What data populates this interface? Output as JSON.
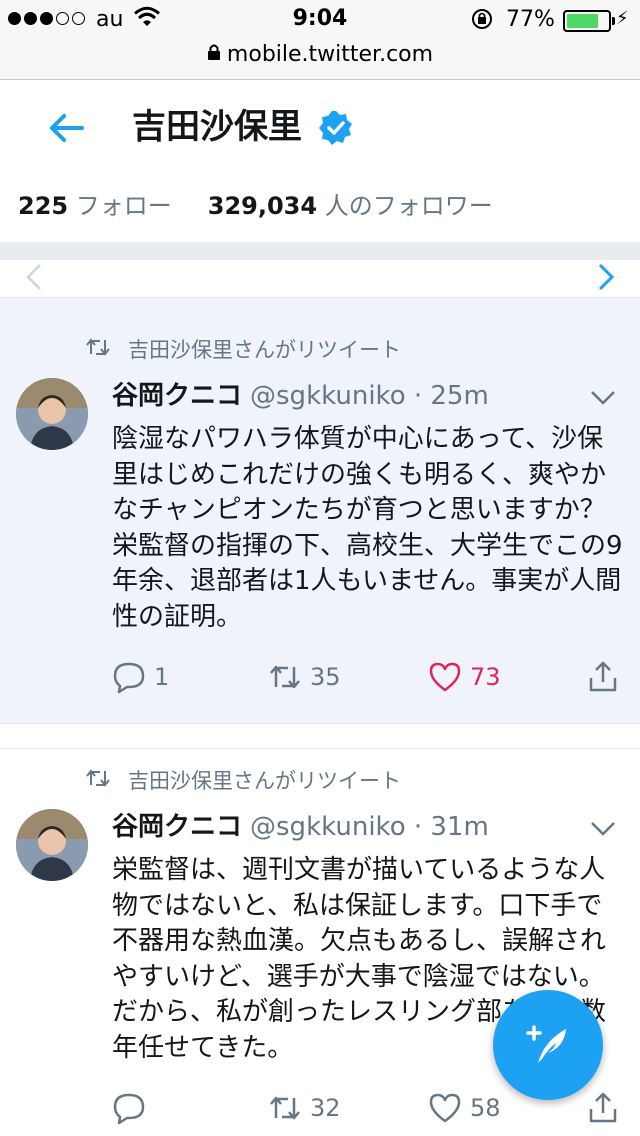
{
  "status_bar": {
    "carrier": "au",
    "time": "9:04",
    "battery_pct": "77%",
    "battery_level": 0.77
  },
  "url_bar": {
    "host": "mobile.twitter.com"
  },
  "profile": {
    "name": "吉田沙保里",
    "following_count": "225",
    "following_label": "フォロー",
    "followers_count": "329,034",
    "followers_label": "人のフォロワー"
  },
  "colors": {
    "accent": "#1da1f2",
    "like": "#e0245e",
    "muted": "#657786"
  },
  "tweets": [
    {
      "retweet_context": "吉田沙保里さんがリツイート",
      "author": "谷岡クニコ",
      "handle_time": "@sgkkuniko · 25m",
      "text": "陰湿なパワハラ体質が中心にあって、沙保里はじめこれだけの強くも明るく、爽やかなチャンピオンたちが育つと思いますか？栄監督の指揮の下、高校生、大学生でこの9年余、退部者は1人もいません。事実が人間性の証明。",
      "replies": "1",
      "retweets": "35",
      "likes": "73",
      "liked": true
    },
    {
      "retweet_context": "吉田沙保里さんがリツイート",
      "author": "谷岡クニコ",
      "handle_time": "@sgkkuniko · 31m",
      "text": "栄監督は、週刊文書が描いているような人物ではないと、私は保証します。口下手で不器用な熱血漢。欠点もあるし、誤解されやすいけど、選手が大事で陰湿ではない。だから、私が創ったレスリング部を二十数年任せてきた。",
      "replies": "",
      "retweets": "32",
      "likes": "58",
      "liked": false
    }
  ]
}
